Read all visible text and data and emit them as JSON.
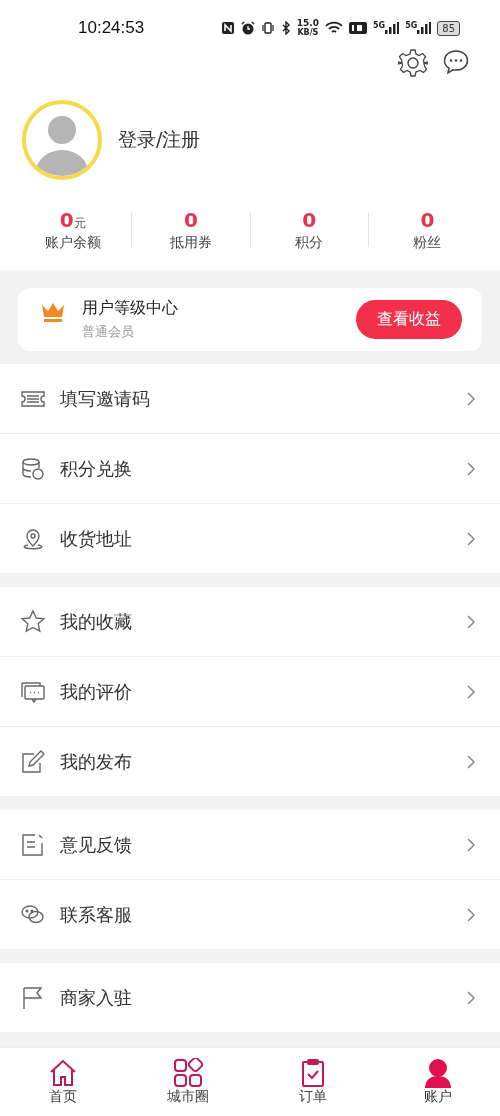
{
  "status_bar": {
    "time": "10:24:53",
    "speed": "15.0",
    "speed_unit": "KB/S",
    "network_1": "5G",
    "network_2": "5G",
    "battery": "85"
  },
  "profile": {
    "login": "登录/注册"
  },
  "stats": [
    {
      "value": "0",
      "unit": "元",
      "label": "账户余额"
    },
    {
      "value": "0",
      "label": "抵用券"
    },
    {
      "value": "0",
      "label": "积分"
    },
    {
      "value": "0",
      "label": "粉丝"
    }
  ],
  "level_card": {
    "title": "用户等级中心",
    "subtitle": "普通会员",
    "button": "查看收益"
  },
  "menu_groups": [
    [
      {
        "label": "填写邀请码"
      },
      {
        "label": "积分兑换"
      },
      {
        "label": "收货地址"
      }
    ],
    [
      {
        "label": "我的收藏"
      },
      {
        "label": "我的评价"
      },
      {
        "label": "我的发布"
      }
    ],
    [
      {
        "label": "意见反馈"
      },
      {
        "label": "联系客服"
      }
    ],
    [
      {
        "label": "商家入驻"
      }
    ]
  ],
  "tab_bar": [
    {
      "label": "首页",
      "selected": false
    },
    {
      "label": "城市圈",
      "selected": false
    },
    {
      "label": "订单",
      "selected": false
    },
    {
      "label": "账户",
      "selected": true
    }
  ]
}
